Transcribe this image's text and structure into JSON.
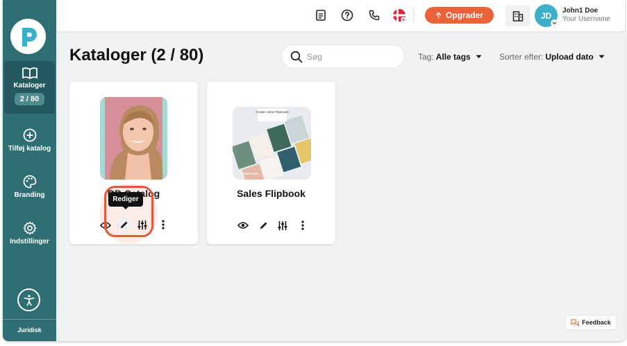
{
  "sidebar": {
    "items": [
      {
        "label": "Kataloger",
        "badge": "2 / 80",
        "icon": "book-open-icon",
        "active": true
      },
      {
        "label": "Tilføj katalog",
        "icon": "plus-circle-icon"
      },
      {
        "label": "Branding",
        "icon": "palette-icon"
      },
      {
        "label": "Indstillinger",
        "icon": "gear-icon"
      }
    ],
    "legal_label": "Juridisk"
  },
  "topbar": {
    "icons": [
      "document-icon",
      "help-icon",
      "phone-icon",
      "danish-flag-icon"
    ],
    "upgrade_label": "Opgrader",
    "user": {
      "initials": "JD",
      "name": "John1 Doe",
      "subtitle": "Your Username"
    }
  },
  "page": {
    "title": "Kataloger (2 / 80)",
    "search_placeholder": "Søg",
    "tag_filter": {
      "label": "Tag:",
      "value": "Alle tags"
    },
    "sort": {
      "label": "Sorter efter:",
      "value": "Upload dato"
    }
  },
  "catalogs": [
    {
      "title": "RB Catalog",
      "tooltip": "Rediger"
    },
    {
      "title": "Sales Flipbook",
      "thumb_text": "Create online Flipbooks",
      "thumb_brand": "PAPERTURN"
    }
  ],
  "feedback_label": "Feedback",
  "colors": {
    "sidebar": "#2f6f74",
    "accent": "#e8633a",
    "avatar": "#3db0c9"
  }
}
